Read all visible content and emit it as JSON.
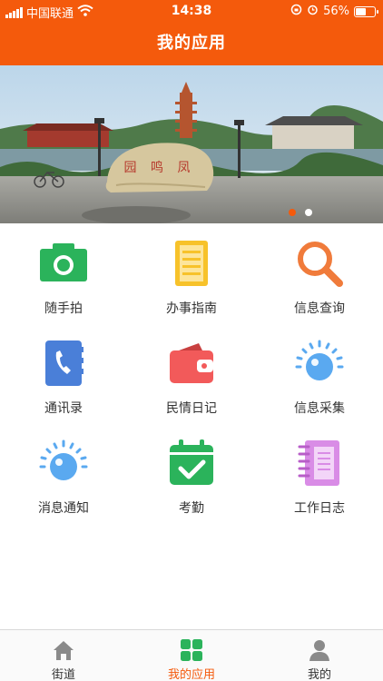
{
  "status_bar": {
    "carrier": "中国联通",
    "time": "14:38",
    "battery": "56%",
    "battery_level": 0.56,
    "icons": [
      "signal-icon",
      "wifi-icon",
      "rotation-lock-icon",
      "alarm-icon",
      "battery-icon"
    ]
  },
  "header": {
    "title": "我的应用"
  },
  "banner": {
    "stone_text": "凤鸣园",
    "slides": 2,
    "active_slide": 0
  },
  "apps": [
    {
      "label": "随手拍",
      "icon": "camera-icon"
    },
    {
      "label": "办事指南",
      "icon": "notebook-icon"
    },
    {
      "label": "信息查询",
      "icon": "magnifier-icon"
    },
    {
      "label": "通讯录",
      "icon": "address-book-icon"
    },
    {
      "label": "民情日记",
      "icon": "wallet-icon"
    },
    {
      "label": "信息采集",
      "icon": "sun-dot-icon"
    },
    {
      "label": "消息通知",
      "icon": "sun-dot-icon"
    },
    {
      "label": "考勤",
      "icon": "calendar-check-icon"
    },
    {
      "label": "工作日志",
      "icon": "spiral-notebook-icon"
    }
  ],
  "tabbar": {
    "tabs": [
      {
        "label": "街道",
        "icon": "home-icon"
      },
      {
        "label": "我的应用",
        "icon": "apps-grid-icon"
      },
      {
        "label": "我的",
        "icon": "person-icon"
      }
    ],
    "active_tab": 1
  },
  "colors": {
    "primary": "#f45a0c",
    "camera": "#2bb35b",
    "notebook": "#f7c22a",
    "magnifier": "#f07b3b",
    "address_book": "#4a7fd8",
    "wallet": "#f25a5a",
    "sun_dot": "#5aa9f0",
    "calendar": "#2bb35b",
    "spiral": "#d98ce6"
  }
}
